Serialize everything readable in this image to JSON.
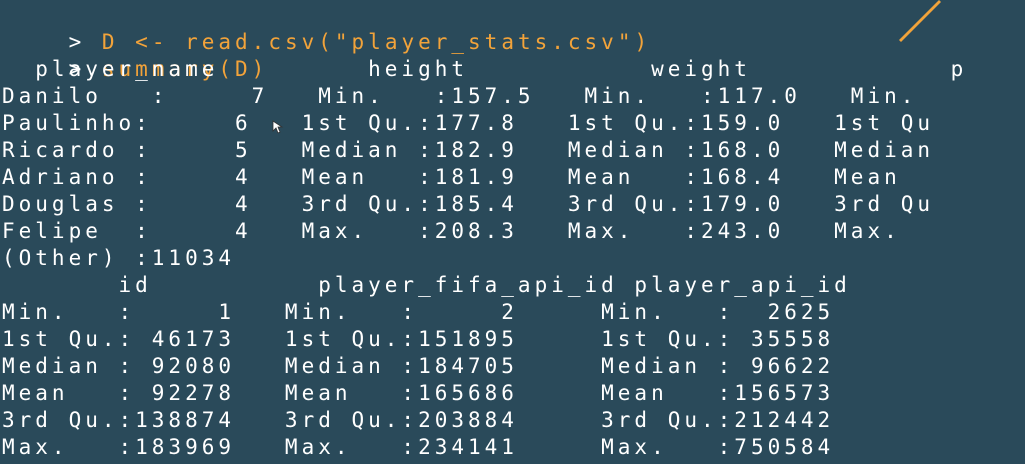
{
  "console": {
    "prompt_symbol": ">",
    "commands": [
      "D <- read.csv(\"player_stats.csv\")",
      "summary(D)"
    ],
    "output_lines": [
      "  player_name         height           weight            p",
      "Danilo   :     7   Min.   :157.5   Min.   :117.0   Min.",
      "Paulinho:     6   1st Qu.:177.8   1st Qu.:159.0   1st Qu",
      "Ricardo :     5   Median :182.9   Median :168.0   Median",
      "Adriano :     4   Mean   :181.9   Mean   :168.4   Mean",
      "Douglas :     4   3rd Qu.:185.4   3rd Qu.:179.0   3rd Qu",
      "Felipe  :     4   Max.   :208.3   Max.   :243.0   Max.",
      "(Other) :11034",
      "       id          player_fifa_api_id player_api_id",
      "Min.   :     1   Min.   :     2     Min.   :  2625",
      "1st Qu.: 46173   1st Qu.:151895     1st Qu.: 35558",
      "Median : 92080   Median :184705     Median : 96622",
      "Mean   : 92278   Mean   :165686     Mean   :156573",
      "3rd Qu.:138874   3rd Qu.:203884     3rd Qu.:212442",
      "Max.   :183969   Max.   :234141     Max.   :750584"
    ]
  },
  "colors": {
    "background": "#2a4a5a",
    "command_text": "#f2a33a",
    "output_text": "#ffffff",
    "accent_stroke": "#f2a33a"
  },
  "icons": {
    "cursor": "mouse-pointer-icon",
    "accent": "orange-slash-stroke"
  }
}
